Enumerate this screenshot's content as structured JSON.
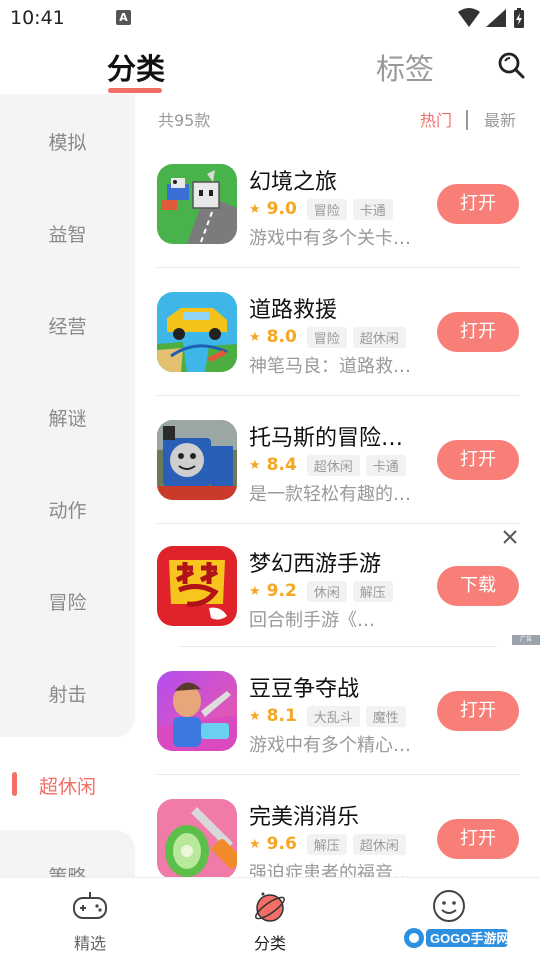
{
  "status_bar": {
    "time": "10:41",
    "notification_icon": "A"
  },
  "header": {
    "tabs": [
      {
        "label": "分类",
        "active": true
      },
      {
        "label": "标签",
        "active": false
      }
    ],
    "search_icon": "search-icon"
  },
  "categories": [
    {
      "label": "模拟"
    },
    {
      "label": "益智"
    },
    {
      "label": "经营"
    },
    {
      "label": "解谜"
    },
    {
      "label": "动作"
    },
    {
      "label": "冒险"
    },
    {
      "label": "射击"
    },
    {
      "label": "超休闲",
      "active": true
    },
    {
      "label": "策略"
    }
  ],
  "list": {
    "count": "共95款",
    "sort": {
      "hot": "热门",
      "new": "最新"
    }
  },
  "apps": [
    {
      "name": "幻境之旅",
      "rating": "9.0",
      "tags": [
        "冒险",
        "卡通"
      ],
      "desc": "游戏中有多个关卡…",
      "button": "打开"
    },
    {
      "name": "道路救援",
      "rating": "8.0",
      "tags": [
        "冒险",
        "超休闲"
      ],
      "desc": "神笔马良：道路救…",
      "button": "打开"
    },
    {
      "name": "托马斯的冒险…",
      "rating": "8.4",
      "tags": [
        "超休闲",
        "卡通"
      ],
      "desc": "是一款轻松有趣的…",
      "button": "打开"
    },
    {
      "name": "梦幻西游手游",
      "rating": "9.2",
      "tags": [
        "休闲",
        "解压"
      ],
      "desc": "回合制手游《…",
      "button": "下载",
      "ad": true
    },
    {
      "name": "豆豆争夺战",
      "rating": "8.1",
      "tags": [
        "大乱斗",
        "魔性"
      ],
      "desc": "游戏中有多个精心…",
      "button": "打开"
    },
    {
      "name": "完美消消乐",
      "rating": "9.6",
      "tags": [
        "解压",
        "超休闲"
      ],
      "desc": "强迫症患者的福音…",
      "button": "打开"
    }
  ],
  "ad_label": "广告",
  "bottom_nav": [
    {
      "label": "精选",
      "icon": "gamepad-icon"
    },
    {
      "label": "分类",
      "icon": "planet-icon",
      "active": true
    },
    {
      "label": "",
      "icon": "smiley-icon"
    }
  ],
  "watermark": "GOGO手游网",
  "colors": {
    "accent": "#f26e67",
    "button": "#f77f77",
    "rating": "#f5a623"
  }
}
